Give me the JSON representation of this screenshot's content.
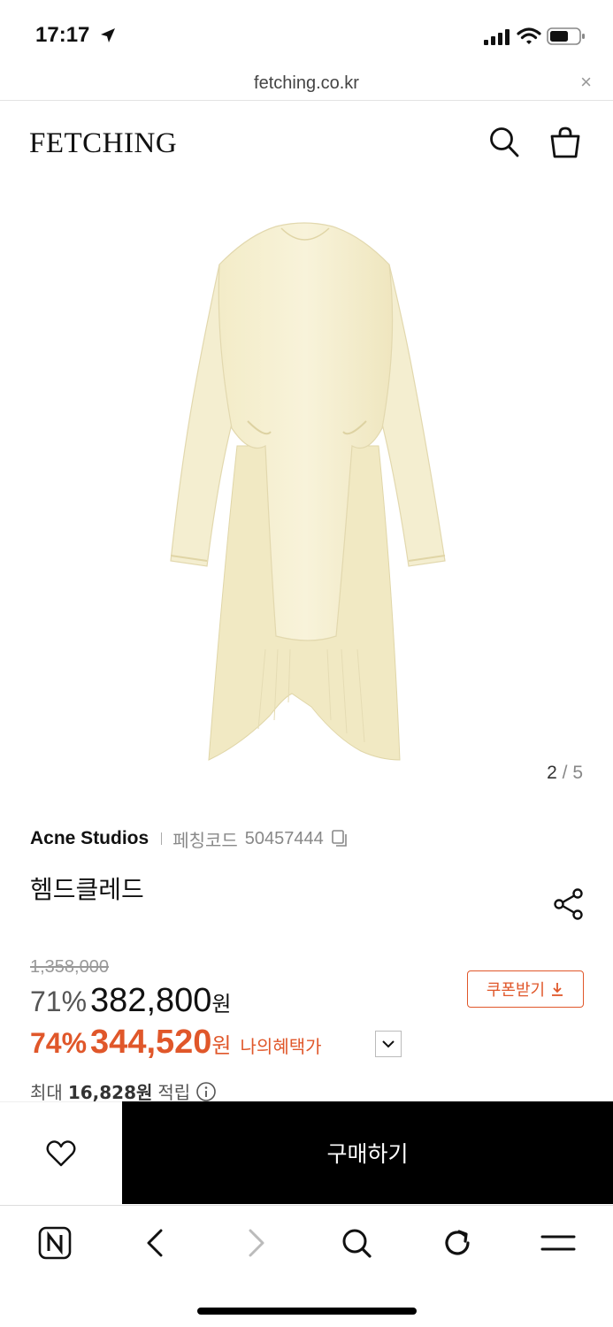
{
  "status_bar": {
    "time": "17:17",
    "icons": [
      "location-arrow-icon",
      "cellular-signal-icon",
      "wifi-icon",
      "battery-icon"
    ]
  },
  "url_bar": {
    "url": "fetching.co.kr",
    "close": "×"
  },
  "header": {
    "logo": "FETCHING",
    "icons": [
      "search-icon",
      "shopping-bag-icon"
    ]
  },
  "gallery": {
    "current": "2",
    "separator": "/",
    "total": "5",
    "image_subject": "cream long-sleeve asymmetric dress"
  },
  "product": {
    "brand": "Acne Studios",
    "code_label": "페칭코드",
    "code": "50457444",
    "name": "헴드클레드",
    "original_price": "1,358,000",
    "discount": "71%",
    "price": "382,800",
    "won": "원",
    "my_discount": "74%",
    "my_price": "344,520",
    "my_won": "원",
    "my_price_label": "나의혜택가",
    "points_prefix": "최대",
    "points_value": "16,828원",
    "points_suffix": "적립",
    "coupon_label": "쿠폰받기"
  },
  "actions": {
    "buy_label": "구매하기"
  },
  "browser_bar": {
    "buttons": [
      "naver-home-icon",
      "back-icon",
      "forward-icon",
      "search-icon",
      "reload-icon",
      "menu-icon"
    ]
  },
  "colors": {
    "accent": "#e0572a",
    "buy_button": "#000000",
    "dress": "#f6f0d2"
  }
}
